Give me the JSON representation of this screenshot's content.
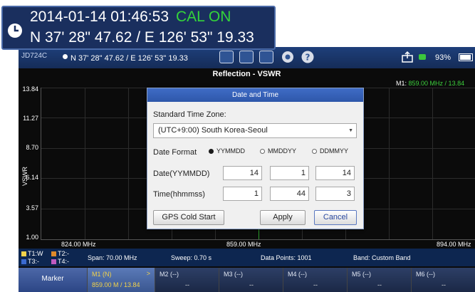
{
  "callout": {
    "datetime": "2014-01-14 01:46:53",
    "cal_status": "CAL ON",
    "coords": "N 37' 28\" 47.62 / E 126' 53\" 19.33"
  },
  "statusbar": {
    "tag": "JD724C",
    "coords": "N 37' 28\" 47.62 / E 126' 53\" 19.33",
    "battery": "93%"
  },
  "plot": {
    "title": "Reflection - VSWR",
    "marker_label": "M1:",
    "marker_value": "859.00 MHz / 13.84",
    "y_axis_label": "VSWR",
    "y_ticks": [
      "13.84",
      "11.27",
      "8.70",
      "6.14",
      "3.57",
      "1.00"
    ],
    "x_ticks": [
      "824.00 MHz",
      "859.00 MHz",
      "894.00 MHz"
    ]
  },
  "legend": {
    "traces": [
      {
        "label": "T1:W",
        "color": "#f2d24a"
      },
      {
        "label": "T2:-",
        "color": "#e08a2a"
      },
      {
        "label": "T3:-",
        "color": "#3a6ad0"
      },
      {
        "label": "T4:-",
        "color": "#c05ac0"
      }
    ],
    "span": "Span: 70.00 MHz",
    "sweep": "Sweep: 0.70 s",
    "points": "Data Points: 1001",
    "band": "Band: Custom Band"
  },
  "softkeys": {
    "marker": "Marker",
    "m1_title": "M1 (N)",
    "m1_arrow": ">",
    "m1_value": "859.00 M / 13.84",
    "m2_title": "M2 (--)",
    "m2_value": "--",
    "m3_title": "M3 (--)",
    "m3_value": "--",
    "m4_title": "M4 (--)",
    "m4_value": "--",
    "m5_title": "M5 (--)",
    "m5_value": "--",
    "m6_title": "M6 (--)",
    "m6_value": "--"
  },
  "dialog": {
    "title": "Date and Time",
    "tz_label": "Standard Time Zone:",
    "tz_value": "(UTC+9:00) South Korea-Seoul",
    "date_format_label": "Date Format",
    "formats": [
      "YYMMDD",
      "MMDDYY",
      "DDMMYY"
    ],
    "selected_format": "YYMMDD",
    "date_label": "Date(YYMMDD)",
    "date_values": [
      "14",
      "1",
      "14"
    ],
    "time_label": "Time(hhmmss)",
    "time_values": [
      "1",
      "44",
      "3"
    ],
    "gps_button": "GPS Cold Start",
    "apply_button": "Apply",
    "cancel_button": "Cancel"
  }
}
